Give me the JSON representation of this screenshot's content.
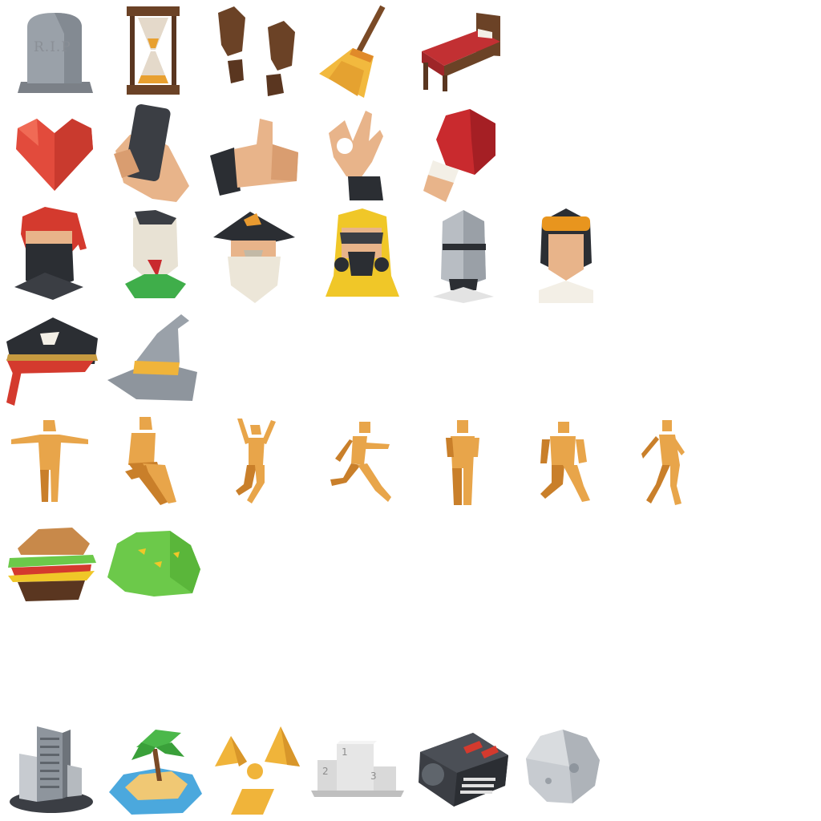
{
  "sheet": {
    "background": "#ffffff",
    "rows": [
      {
        "group": "objects",
        "icons": [
          "tombstone-icon",
          "hourglass-icon",
          "footprints-icon",
          "broom-icon",
          "bed-icon"
        ]
      },
      {
        "group": "gestures",
        "icons": [
          "heart-icon",
          "hand-phone-icon",
          "thumbs-up-icon",
          "ok-hand-icon",
          "boxing-glove-icon"
        ]
      },
      {
        "group": "avatars",
        "icons": [
          "ninja-head-icon",
          "zombie-head-icon",
          "wizard-head-icon",
          "hazmat-head-icon",
          "knight-helmet-icon",
          "racer-head-icon"
        ]
      },
      {
        "group": "hats",
        "icons": [
          "pirate-hat-icon",
          "wizard-hat-icon"
        ]
      },
      {
        "group": "poses",
        "icons": [
          "t-pose-figure-icon",
          "sitting-figure-icon",
          "jumping-figure-icon",
          "running-figure-icon",
          "standing-figure-icon",
          "kneeling-figure-icon",
          "walking-figure-icon"
        ]
      },
      {
        "group": "misc",
        "icons": [
          "burger-icon",
          "grass-island-icon"
        ]
      },
      {
        "group": "places",
        "icons": [
          "skyscraper-icon",
          "palm-island-icon",
          "radiation-icon",
          "podium-icon",
          "engine-icon",
          "moon-icon"
        ]
      }
    ]
  },
  "labels": {
    "tombstone": "R.I.P",
    "podium": [
      "1",
      "2",
      "3"
    ]
  },
  "colors": {
    "figure": "#e8a54a",
    "figure_shade": "#c97f2a",
    "stone": "#8e959d",
    "wood": "#6b4226",
    "red": "#d9403a",
    "skin": "#e8b48a",
    "grass": "#6cc94a",
    "yellow": "#f0c728"
  }
}
